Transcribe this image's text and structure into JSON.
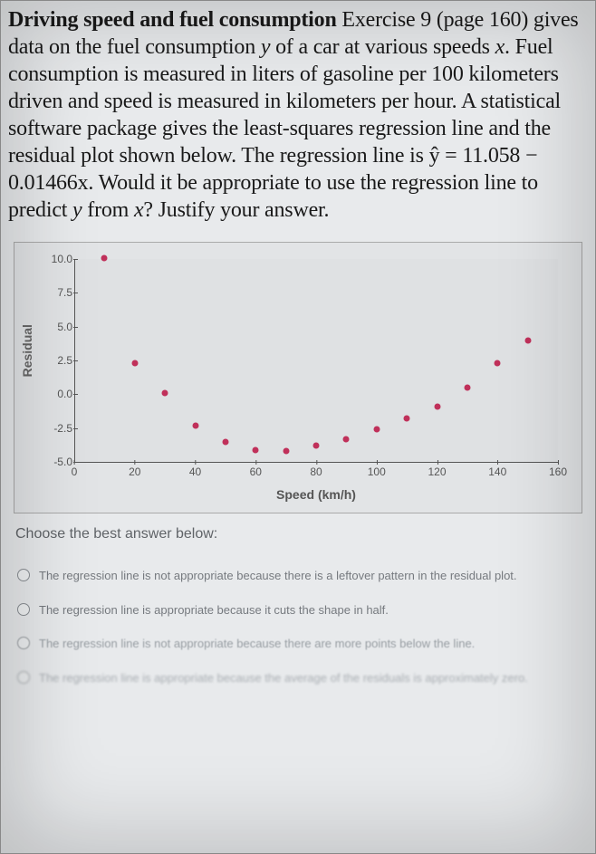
{
  "question": {
    "text_parts": {
      "p1": "Driving speed and fuel consumption",
      "p2": "  Exercise 9 (page 160) gives data on the fuel consumption ",
      "yvar": "y",
      "p3": " of a car at various speeds ",
      "xvar": "x",
      "p4": ". Fuel consumption is measured in liters of gasoline per 100 kilometers driven and speed is measured in kilometers per hour. A statistical software package gives the least-squares regression line and the residual plot shown below. The regression line is ŷ = 11.058 − 0.01466x. Would it be appropriate to use the regression line to predict ",
      "yvar2": "y",
      "p5": " from ",
      "xvar2": "x",
      "p6": "? Justify your answer."
    }
  },
  "chart_data": {
    "type": "scatter",
    "title": "",
    "xlabel": "Speed (km/h)",
    "ylabel": "Residual",
    "xlim": [
      0,
      160
    ],
    "ylim": [
      -5.0,
      10.0
    ],
    "xticks": [
      0,
      20,
      40,
      60,
      80,
      100,
      120,
      140,
      160
    ],
    "yticks": [
      -5.0,
      -2.5,
      0.0,
      2.5,
      5.0,
      7.5,
      10.0
    ],
    "series": [
      {
        "name": "residuals",
        "x": [
          10,
          20,
          30,
          40,
          50,
          60,
          70,
          80,
          90,
          100,
          110,
          120,
          130,
          140,
          150
        ],
        "y": [
          10.1,
          2.3,
          0.1,
          -2.3,
          -3.5,
          -4.1,
          -4.2,
          -3.8,
          -3.3,
          -2.6,
          -1.8,
          -0.9,
          0.5,
          2.3,
          4.0
        ]
      }
    ],
    "colors": {
      "point": "#c0305a"
    }
  },
  "prompt": "Choose the best answer below:",
  "options": [
    "The regression line is not appropriate because there is a leftover pattern in the residual plot.",
    "The regression line is appropriate because it cuts the shape in half.",
    "The regression line is not appropriate because there are more points below the line.",
    "The regression line is appropriate because the average of the residuals is approximately zero."
  ]
}
